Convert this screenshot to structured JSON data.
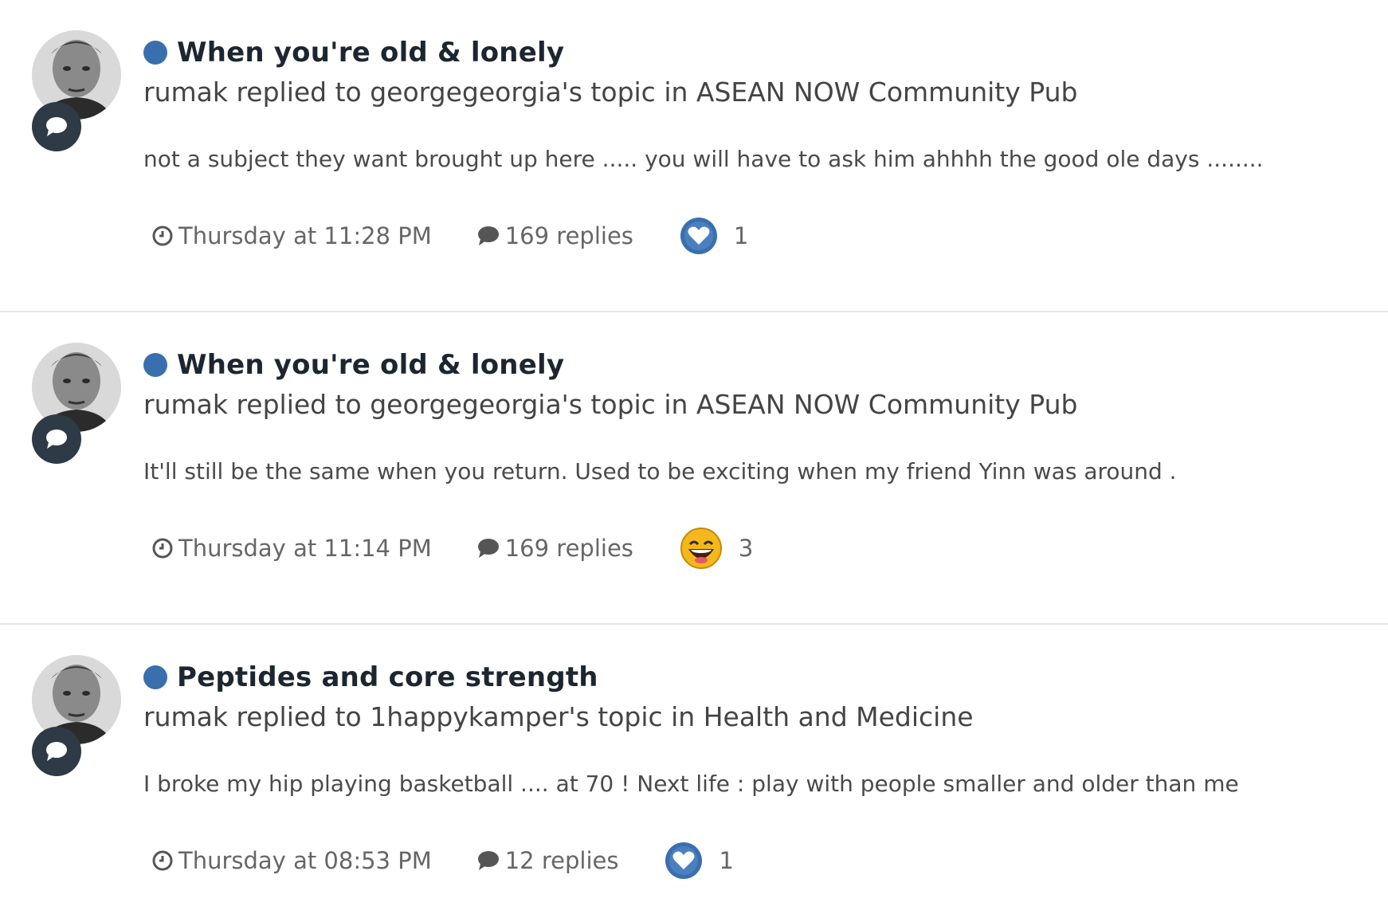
{
  "colors": {
    "unread_dot": "#3a6fae",
    "title": "#1d2630",
    "badge_bg": "#2e3a46",
    "like_blue": "#3a6fae",
    "divider": "#e6e6e6"
  },
  "items": [
    {
      "title": "When you're old & lonely",
      "meta": "rumak replied to georgegeorgia's topic in ASEAN NOW Community Pub",
      "snippet": "not a subject they want brought up here ..... you will have to ask him ahhhh the good ole days ........",
      "time": "Thursday at 11:28 PM",
      "replies": "169 replies",
      "reaction_icon": "heart-like-icon",
      "reaction_count": "1"
    },
    {
      "title": "When you're old & lonely",
      "meta": "rumak replied to georgegeorgia's topic in ASEAN NOW Community Pub",
      "snippet": "It'll still be the same when you return. Used to be exciting when my friend Yinn was around .",
      "time": "Thursday at 11:14 PM",
      "replies": "169 replies",
      "reaction_icon": "laughing-emoji-icon",
      "reaction_count": "3"
    },
    {
      "title": "Peptides and core strength",
      "meta": "rumak replied to 1happykamper's topic in Health and Medicine",
      "snippet": "I broke my hip playing basketball .... at 70 ! Next life : play with people smaller and older than me",
      "time": "Thursday at 08:53 PM",
      "replies": "12 replies",
      "reaction_icon": "heart-like-icon",
      "reaction_count": "1"
    }
  ]
}
